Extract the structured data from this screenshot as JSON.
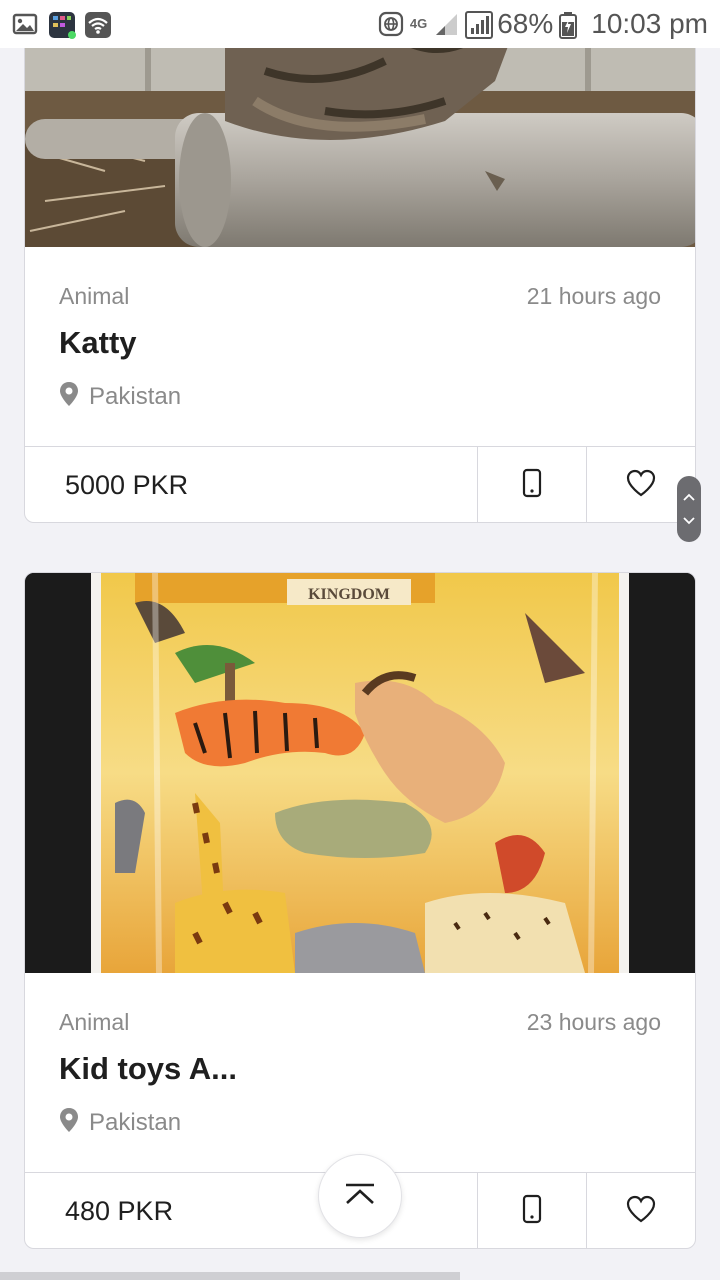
{
  "status_bar": {
    "network": "4G",
    "battery": "68%",
    "time": "10:03 pm",
    "icons": [
      "gallery-icon",
      "app-notification-icon",
      "wifi-icon",
      "vpn-globe-icon",
      "signal-icon",
      "signal-icon",
      "battery-icon"
    ]
  },
  "listings": [
    {
      "category": "Animal",
      "time": "21 hours ago",
      "title": "Katty",
      "location": "Pakistan",
      "price": "5000 PKR"
    },
    {
      "category": "Animal",
      "time": "23 hours ago",
      "title": "Kid toys A...",
      "location": "Pakistan",
      "price": "480 PKR",
      "image_banner": "KINGDOM"
    }
  ],
  "colors": {
    "background": "#f2f2f6",
    "card": "#ffffff",
    "muted_text": "#8a8a8a",
    "title_text": "#1f1f1f",
    "border": "#d8d8de"
  }
}
